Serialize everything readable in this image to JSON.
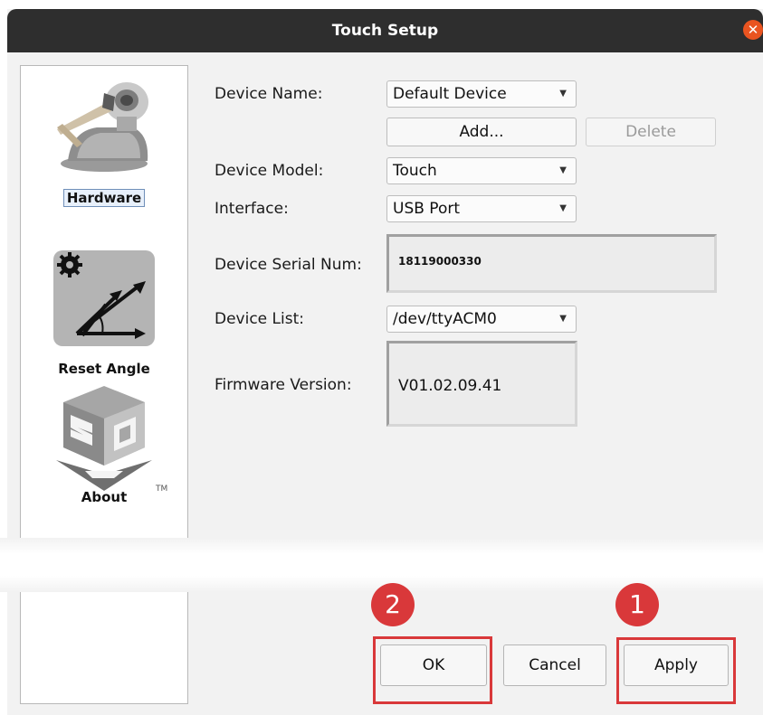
{
  "window": {
    "title": "Touch Setup",
    "close_icon": "close-icon"
  },
  "sidebar": {
    "items": [
      {
        "label": "Hardware",
        "icon": "haptic-device-icon"
      },
      {
        "label": "Reset Angle",
        "icon": "reset-angle-icon"
      },
      {
        "label": "About",
        "icon": "3d-systems-logo",
        "trademark": "TM"
      }
    ]
  },
  "form": {
    "device_name": {
      "label": "Device Name:",
      "value": "Default Device"
    },
    "add_label": "Add...",
    "delete_label": "Delete",
    "device_model": {
      "label": "Device Model:",
      "value": "Touch"
    },
    "interface": {
      "label": "Interface:",
      "value": "USB Port"
    },
    "serial": {
      "label": "Device Serial Num:",
      "value": "18119000330"
    },
    "device_list": {
      "label": "Device List:",
      "value": "/dev/ttyACM0"
    },
    "firmware": {
      "label": "Firmware Version:",
      "value": "V01.02.09.41"
    }
  },
  "buttons": {
    "ok": "OK",
    "cancel": "Cancel",
    "apply": "Apply"
  },
  "annotations": {
    "marker_ok": "2",
    "marker_apply": "1",
    "color": "#d9383a"
  }
}
